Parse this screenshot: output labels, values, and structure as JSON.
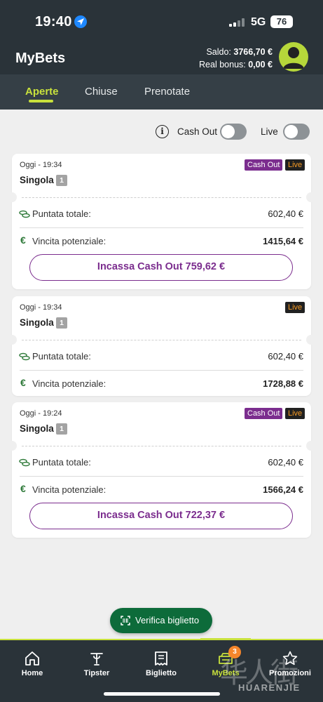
{
  "status_bar": {
    "time": "19:40",
    "network": "5G",
    "battery": "76"
  },
  "header": {
    "title": "MyBets",
    "saldo_label": "Saldo:",
    "saldo_value": "3766,70 €",
    "bonus_label": "Real bonus:",
    "bonus_value": "0,00 €"
  },
  "tabs": [
    {
      "label": "Aperte",
      "active": true
    },
    {
      "label": "Chiuse",
      "active": false
    },
    {
      "label": "Prenotate",
      "active": false
    }
  ],
  "filters": {
    "info_glyph": "i",
    "cashout_label": "Cash Out",
    "cashout_on": false,
    "live_label": "Live",
    "live_on": false
  },
  "bets": [
    {
      "date": "Oggi - 19:34",
      "type": "Singola",
      "count": "1",
      "badge_cashout": "Cash Out",
      "badge_live": "Live",
      "stake_label": "Puntata totale:",
      "stake_value": "602,40 €",
      "win_label": "Vincita potenziale:",
      "win_value": "1415,64 €",
      "cashout_button": "Incassa Cash Out 759,62 €"
    },
    {
      "date": "Oggi - 19:34",
      "type": "Singola",
      "count": "1",
      "badge_live": "Live",
      "stake_label": "Puntata totale:",
      "stake_value": "602,40 €",
      "win_label": "Vincita potenziale:",
      "win_value": "1728,88 €"
    },
    {
      "date": "Oggi - 19:24",
      "type": "Singola",
      "count": "1",
      "badge_cashout": "Cash Out",
      "badge_live": "Live",
      "stake_label": "Puntata totale:",
      "stake_value": "602,40 €",
      "win_label": "Vincita potenziale:",
      "win_value": "1566,24 €",
      "cashout_button": "Incassa Cash Out 722,37 €"
    }
  ],
  "euro_glyph": "€",
  "verify_button": "Verifica biglietto",
  "bottom_nav": [
    {
      "label": "Home",
      "icon": "home-icon"
    },
    {
      "label": "Tipster",
      "icon": "tipster-icon"
    },
    {
      "label": "Biglietto",
      "icon": "ticket-icon"
    },
    {
      "label": "MyBets",
      "icon": "mybets-icon",
      "badge": "3",
      "active": true
    },
    {
      "label": "Promozioni",
      "icon": "star-icon"
    }
  ],
  "watermark": {
    "script": "华人街",
    "text": "HUARENJIE"
  },
  "colors": {
    "header_bg": "#2a3339",
    "accent_lime": "#c8e13c",
    "cashout_purple": "#7b2d8e",
    "live_orange": "#f59a23",
    "verify_green": "#0d6b3a",
    "badge_orange": "#f5862b"
  }
}
